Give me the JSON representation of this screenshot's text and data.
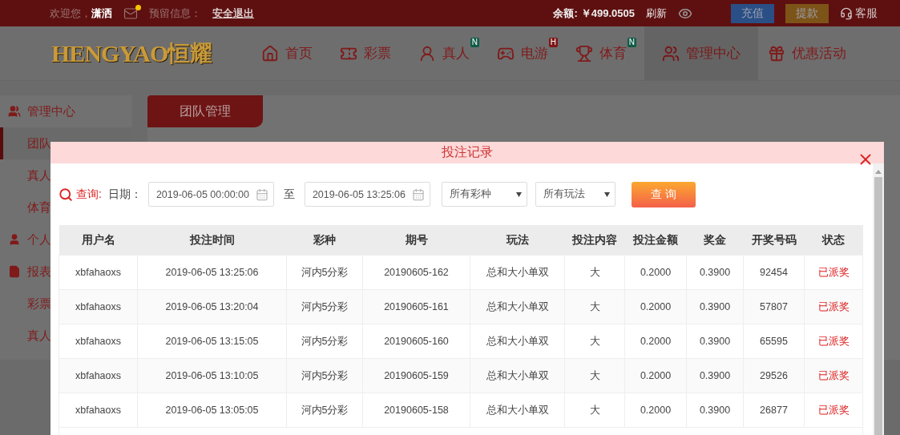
{
  "top_bar": {
    "greeting": "欢迎您，",
    "username": "潇洒",
    "mail_unread": true,
    "reserved_info": "预留信息：",
    "logout": "安全退出",
    "balance_label": "余额:",
    "balance": "￥499.0505",
    "refresh": "刷新",
    "deposit": "充值",
    "withdraw": "提款",
    "service": "客服"
  },
  "logo": {
    "latin": "HENGYAO",
    "cjk": "恒耀"
  },
  "nav": [
    {
      "label": "首页",
      "selected": false
    },
    {
      "label": "彩票",
      "selected": false
    },
    {
      "label": "真人",
      "selected": false,
      "badge": {
        "text": "N",
        "color": "#0f5c47"
      }
    },
    {
      "label": "电游",
      "selected": false,
      "badge": {
        "text": "H",
        "color": "#7c1616"
      }
    },
    {
      "label": "体育",
      "selected": false,
      "badge": {
        "text": "N",
        "color": "#0f5c47"
      }
    },
    {
      "label": "管理中心",
      "selected": true
    },
    {
      "label": "优惠活动",
      "selected": false
    }
  ],
  "sidebar": {
    "groups": [
      {
        "label": "管理中心",
        "children": [
          {
            "label": "团队",
            "selected": true
          },
          {
            "label": "真人",
            "selected": false
          },
          {
            "label": "体育",
            "selected": false
          }
        ]
      },
      {
        "label": "个人"
      },
      {
        "label": "报表",
        "children": [
          {
            "label": "彩票",
            "selected": false
          },
          {
            "label": "真人",
            "selected": false
          }
        ]
      }
    ]
  },
  "content_tab": "团队管理",
  "modal": {
    "title": "投注记录",
    "filter": {
      "query_label": "查询:",
      "date_label": "日期：",
      "date_from": "2019-06-05 00:00:00",
      "separator": "至",
      "date_to": "2019-06-05 13:25:06",
      "lottery_select": "所有彩种",
      "play_select": "所有玩法",
      "search_button": "查 询"
    },
    "table": {
      "columns": [
        "用户名",
        "投注时间",
        "彩种",
        "期号",
        "玩法",
        "投注内容",
        "投注金额",
        "奖金",
        "开奖号码",
        "状态"
      ],
      "rows": [
        [
          "xbfahaoxs",
          "2019-06-05 13:25:06",
          "河内5分彩",
          "20190605-162",
          "总和大小单双",
          "大",
          "0.2000",
          "0.3900",
          "92454",
          "已派奖"
        ],
        [
          "xbfahaoxs",
          "2019-06-05 13:20:04",
          "河内5分彩",
          "20190605-161",
          "总和大小单双",
          "大",
          "0.2000",
          "0.3900",
          "57807",
          "已派奖"
        ],
        [
          "xbfahaoxs",
          "2019-06-05 13:15:05",
          "河内5分彩",
          "20190605-160",
          "总和大小单双",
          "大",
          "0.2000",
          "0.3900",
          "65595",
          "已派奖"
        ],
        [
          "xbfahaoxs",
          "2019-06-05 13:10:05",
          "河内5分彩",
          "20190605-159",
          "总和大小单双",
          "大",
          "0.2000",
          "0.3900",
          "29526",
          "已派奖"
        ],
        [
          "xbfahaoxs",
          "2019-06-05 13:05:05",
          "河内5分彩",
          "20190605-158",
          "总和大小单双",
          "大",
          "0.2000",
          "0.3900",
          "26877",
          "已派奖"
        ]
      ]
    }
  }
}
